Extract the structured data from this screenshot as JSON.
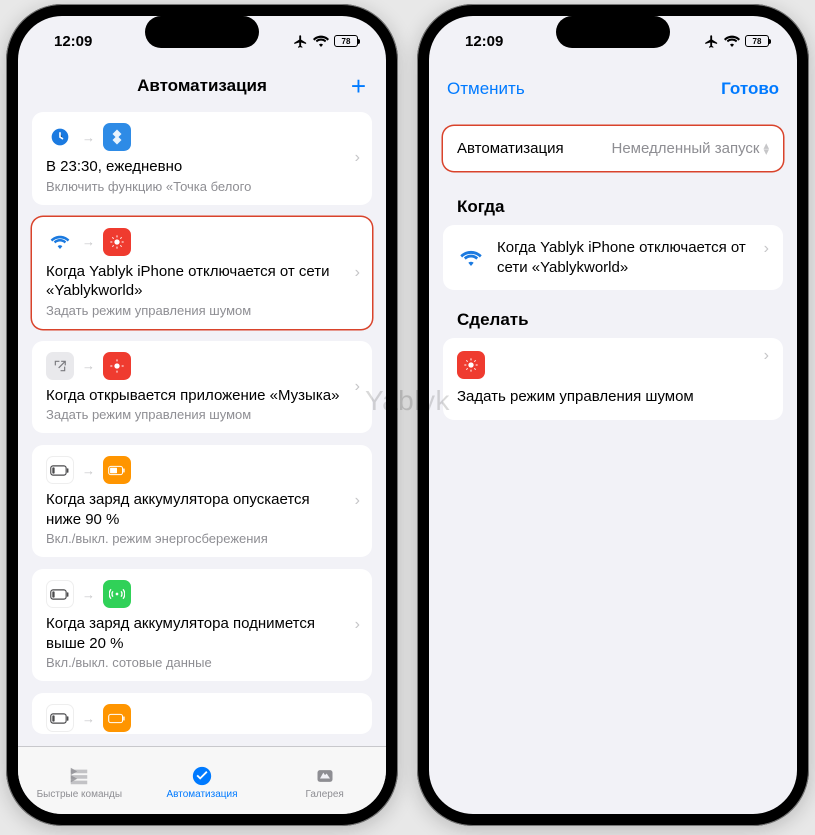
{
  "status": {
    "time": "12:09",
    "battery": "78"
  },
  "watermark": "Yablyk",
  "left": {
    "header_title": "Автоматизация",
    "add_symbol": "+",
    "cards": [
      {
        "title": "В 23:30, ежедневно",
        "sub": "Включить функцию «Точка белого"
      },
      {
        "title": "Когда Yablyk iPhone отключается от сети «Yablykworld»",
        "sub": "Задать режим управления шумом"
      },
      {
        "title": "Когда открывается приложение «Музыка»",
        "sub": "Задать режим управления шумом"
      },
      {
        "title": "Когда заряд аккумулятора опускается ниже 90 %",
        "sub": "Вкл./выкл. режим энергосбережения"
      },
      {
        "title": "Когда заряд аккумулятора поднимется выше 20 %",
        "sub": "Вкл./выкл. сотовые данные"
      }
    ],
    "tabs": {
      "shortcuts": "Быстрые команды",
      "automation": "Автоматизация",
      "gallery": "Галерея"
    }
  },
  "right": {
    "cancel": "Отменить",
    "done": "Готово",
    "selector_label": "Автоматизация",
    "selector_value": "Немедленный запуск",
    "when_header": "Когда",
    "when_text": "Когда Yablyk iPhone отключается от сети «Yablykworld»",
    "do_header": "Сделать",
    "do_text": "Задать режим управления шумом"
  }
}
